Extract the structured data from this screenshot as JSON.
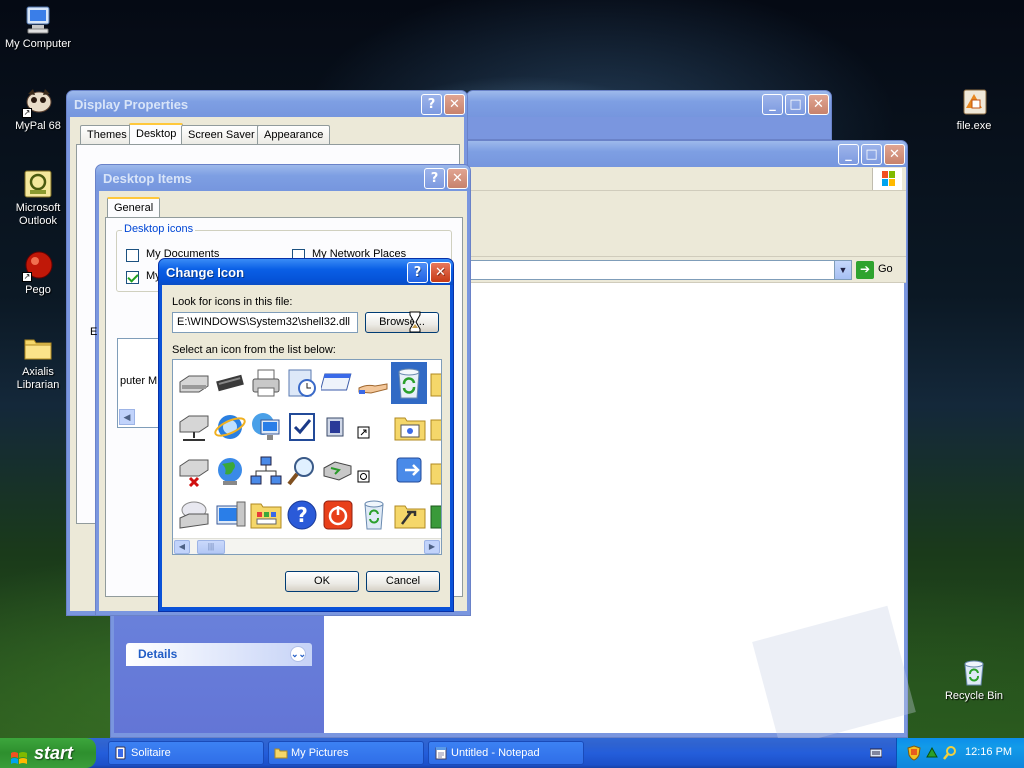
{
  "desktop_icons": [
    {
      "label": "My Computer",
      "icon": "computer-icon"
    },
    {
      "label": "MyPal 68",
      "icon": "browser-icon"
    },
    {
      "label": "Microsoft Outlook",
      "icon": "outlook-icon"
    },
    {
      "label": "Pego",
      "icon": "pego-icon"
    },
    {
      "label": "Axialis Librarian",
      "icon": "folder-icon"
    },
    {
      "label": "file.exe",
      "icon": "file-icon"
    },
    {
      "label": "Recycle Bin",
      "icon": "recycle-bin-icon"
    }
  ],
  "display_properties": {
    "title": "Display Properties",
    "tabs": [
      "Themes",
      "Desktop",
      "Screen Saver",
      "Appearance"
    ],
    "selected_tab": "Desktop"
  },
  "desktop_items": {
    "title": "Desktop Items",
    "tab": "General",
    "group_label": "Desktop icons",
    "checkboxes": [
      {
        "label": "My Documents",
        "checked": false
      },
      {
        "label": "My Network Places",
        "checked": false
      },
      {
        "label": "My",
        "checked": true
      }
    ],
    "truncated_labels": [
      "puter",
      "M",
      "E"
    ]
  },
  "change_icon": {
    "title": "Change Icon",
    "look_label": "Look for icons in this file:",
    "file_path": "E:\\WINDOWS\\System32\\shell32.dll",
    "browse_label": "Browse...",
    "select_label": "Select an icon from the list below:",
    "ok_label": "OK",
    "cancel_label": "Cancel"
  },
  "explorer": {
    "go_label": "Go",
    "details_label": "Details"
  },
  "taskbar": {
    "start_label": "start",
    "tasks": [
      "Solitaire",
      "My Pictures",
      "Untitled - Notepad"
    ],
    "clock": "12:16 PM"
  },
  "colors": {
    "title_active": "#0a5fe6",
    "title_inactive": "#7e9fe3",
    "dialog_bg": "#ece9d8",
    "taskbar": "#245edb",
    "start": "#2e8f2e"
  }
}
